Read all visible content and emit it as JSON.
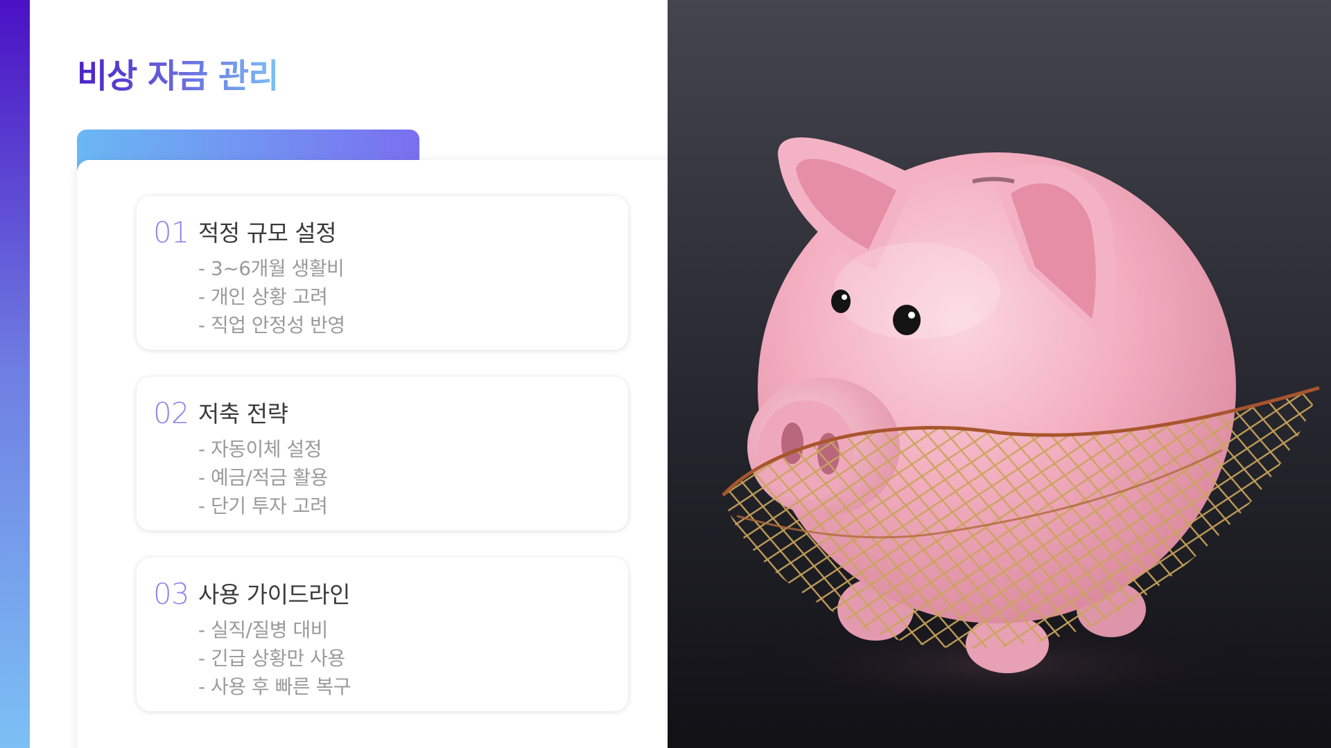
{
  "slide": {
    "title": "비상 자금 관리",
    "sections": [
      {
        "number": "01",
        "heading": "적정 규모 설정",
        "items": [
          "- 3~6개월 생활비",
          "- 개인 상황 고려",
          "- 직업 안정성 반영"
        ]
      },
      {
        "number": "02",
        "heading": "저축 전략",
        "items": [
          "- 자동이체 설정",
          "- 예금/적금 활용",
          "- 단기 투자 고려"
        ]
      },
      {
        "number": "03",
        "heading": "사용 가이드라인",
        "items": [
          "- 실직/질병 대비",
          "- 긴급 상황만 사용",
          "- 사용 후 빠른 복구"
        ]
      }
    ]
  },
  "image": {
    "subject": "piggy-bank-in-net",
    "colors": {
      "background": "#2c2c35",
      "pig": "#f2a9bd",
      "net": "#c9a45a"
    }
  }
}
